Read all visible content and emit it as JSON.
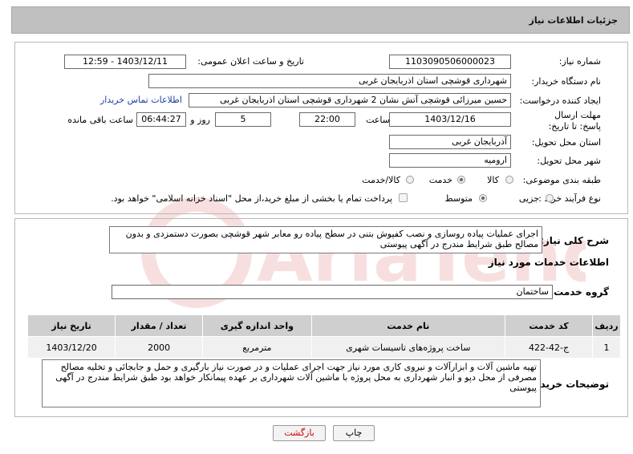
{
  "page_title": "جزئیات اطلاعات نیاز",
  "need_number": {
    "label": "شماره نیاز:",
    "value": "1103090506000023"
  },
  "announce_datetime": {
    "label": "تاریخ و ساعت اعلان عمومی:",
    "value": "1403/12/11 - 12:59"
  },
  "buyer_org": {
    "label": "نام دستگاه خریدار:",
    "value": "شهرداری قوشچی استان اذربایجان غربی"
  },
  "requester": {
    "label": "ایجاد کننده درخواست:",
    "value": "حسین میرزائی قوشچی آتش نشان 2 شهرداری قوشچی استان اذربایجان غربی",
    "contact_link": "اطلاعات تماس خریدار"
  },
  "deadline": {
    "label": "مهلت ارسال پاسخ: تا تاریخ:",
    "date": "1403/12/16",
    "time_label": "ساعت",
    "time": "22:00",
    "days": "5",
    "days_label": "روز و",
    "remaining": "06:44:27",
    "remaining_label": "ساعت باقی مانده"
  },
  "delivery_province": {
    "label": "استان محل تحویل:",
    "value": "آذربایجان غربی"
  },
  "delivery_city": {
    "label": "شهر محل تحویل:",
    "value": "ارومیه"
  },
  "category": {
    "label": "طبقه بندی موضوعی:",
    "options": [
      "کالا",
      "خدمت",
      "کالا/خدمت"
    ],
    "selected": "خدمت"
  },
  "purchase_type": {
    "label": "نوع فرآیند خرید :",
    "options": [
      "جزیی",
      "متوسط"
    ],
    "selected": "متوسط",
    "payment_note": "پرداخت تمام یا بخشی از مبلغ خرید،از محل \"اسناد خزانه اسلامی\" خواهد بود."
  },
  "general_description": {
    "label": "شرح کلی نیاز:",
    "value": "اجرای عملیات پیاده روسازی و نصب کفپوش بتنی در سطح پیاده رو معابر شهر قوشچی بصورت دستمزدی و بدون مصالح طبق شرایط مندرج در آگهی پیوستی"
  },
  "services_section": {
    "title": "اطلاعات خدمات مورد نیاز",
    "group_label": "گروه خدمت:",
    "group_value": "ساختمان"
  },
  "table": {
    "headers": [
      "ردیف",
      "کد خدمت",
      "نام خدمت",
      "واحد اندازه گیری",
      "تعداد / مقدار",
      "تاریخ نیاز"
    ],
    "rows": [
      [
        "1",
        "ج-42-422",
        "ساخت پروژه‌های تاسیسات شهری",
        "مترمربع",
        "2000",
        "1403/12/20"
      ]
    ]
  },
  "buyer_notes": {
    "label": "توضیحات خریدار:",
    "value": "تهیه ماشین آلات و ابزارآلات و نیروی کاری مورد نیاز جهت اجرای عملیات و در صورت نیاز بارگیری و حمل و جابجائی و تخلیه مصالح مصرفی از محل دپو و انبار شهرداری به محل پروژه با ماشین آلات شهرداری بر عهده پیمانکار خواهد بود طبق شرایط مندرج در آگهی پیوستی"
  },
  "buttons": {
    "print": "چاپ",
    "back": "بازگشت"
  },
  "colors": {
    "title_bg": "#c0c0c0",
    "table_header_bg": "#cfcfcf",
    "link": "#1f3ea0",
    "back_button_text": "#cc0000"
  }
}
